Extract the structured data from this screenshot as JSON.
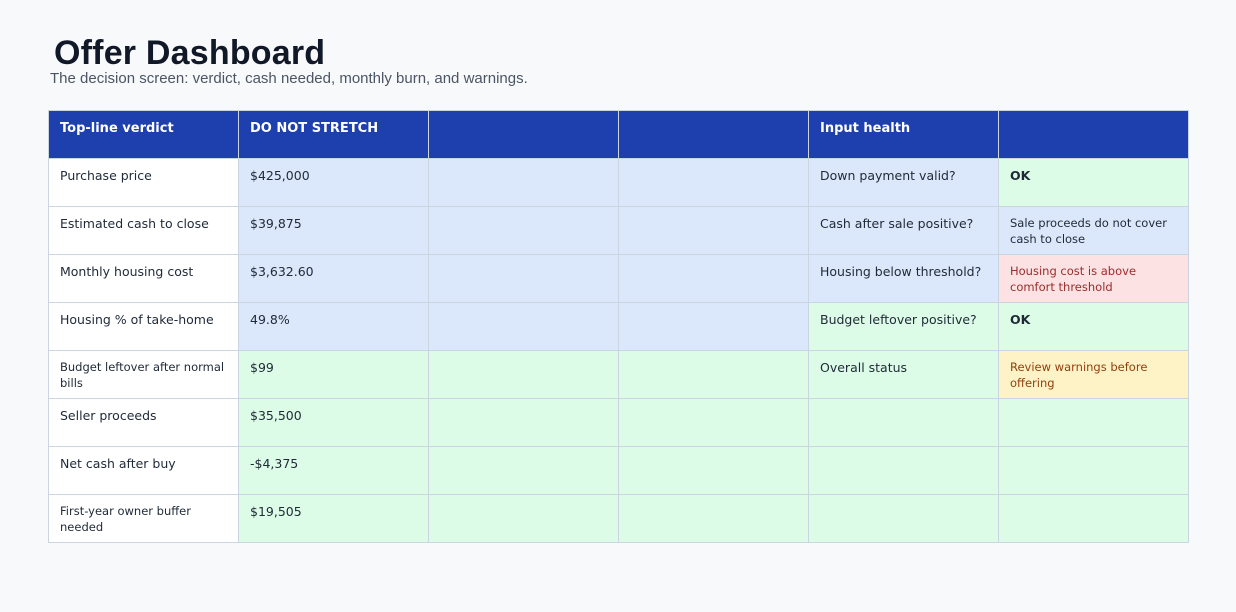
{
  "header": {
    "title": "Offer Dashboard",
    "subtitle": "The decision screen: verdict, cash needed, monthly burn, and warnings."
  },
  "table": {
    "head": {
      "col1": "Top-line verdict",
      "col2": "DO NOT STRETCH",
      "col5": "Input health"
    },
    "rows": [
      {
        "label": "Purchase price",
        "value": "$425,000",
        "check": "Down payment valid?",
        "status": "OK"
      },
      {
        "label": "Estimated cash to close",
        "value": "$39,875",
        "check": "Cash after sale positive?",
        "status": "Sale proceeds do not cover cash to close"
      },
      {
        "label": "Monthly housing cost",
        "value": "$3,632.60",
        "check": "Housing below threshold?",
        "status": "Housing cost is above comfort threshold"
      },
      {
        "label": "Housing % of take-home",
        "value": "49.8%",
        "check": "Budget leftover positive?",
        "status": "OK"
      },
      {
        "label": "Budget leftover after normal bills",
        "value": "$99",
        "check": "Overall status",
        "status": "Review warnings before offering"
      },
      {
        "label": "Seller proceeds",
        "value": "$35,500",
        "check": "",
        "status": ""
      },
      {
        "label": "Net cash after buy",
        "value": "-$4,375",
        "check": "",
        "status": ""
      },
      {
        "label": "First-year owner buffer needed",
        "value": "$19,505",
        "check": "",
        "status": ""
      }
    ]
  },
  "colors": {
    "header_bg": "#1e40af",
    "blue_fill": "#dbe8fb",
    "green_fill": "#dcfce7",
    "red_fill": "#fde2e4",
    "yellow_fill": "#fef3c7"
  }
}
